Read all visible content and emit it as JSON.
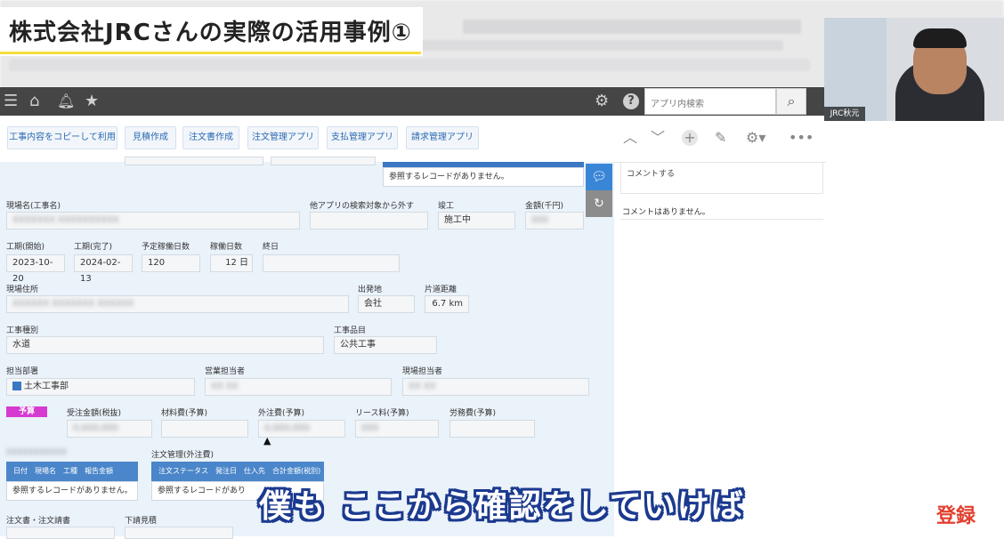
{
  "banner": {
    "title": "株式会社JRCさんの実際の活用事例①"
  },
  "search": {
    "placeholder": "アプリ内検索"
  },
  "actions": [
    {
      "label": "工事内容をコピーして利用"
    },
    {
      "label": "見積作成"
    },
    {
      "label": "注文書作成"
    },
    {
      "label": "注文管理アプリ"
    },
    {
      "label": "支払管理アプリ"
    },
    {
      "label": "請求管理アプリ"
    }
  ],
  "icons": {
    "menu": "menu-icon",
    "home": "home-icon",
    "bell": "bell-icon",
    "star": "star-icon",
    "gear": "gear-icon",
    "help": "help-icon",
    "search": "search-icon",
    "prev": "chevron-up-icon",
    "next": "chevron-down-icon",
    "add": "plus-icon",
    "edit": "edit-icon",
    "settings": "gear-icon",
    "more": "more-icon"
  },
  "colors": {
    "header": "#454545",
    "form_bg": "#eaf2fa",
    "table_head": "#4a86c9",
    "budget_tag": "#d63ad0",
    "subtitle_outline": "#1b3a8f"
  },
  "form": {
    "ref_none_top": "参照するレコードがありません。",
    "site_name_label": "現場名(工事名)",
    "exclude_label": "他アプリの検索対象から外す",
    "completion_label": "竣工",
    "completion_value": "施工中",
    "amount_label": "金額(千円)",
    "start_label": "工期(開始)",
    "start_value": "2023-10-20",
    "end_label": "工期(完了)",
    "end_value": "2024-02-13",
    "planned_days_label": "予定稼働日数",
    "planned_days_value": "120",
    "working_days_label": "稼働日数",
    "working_days_value": "12",
    "working_days_unit": "日",
    "final_day_label": "終日",
    "address_label": "現場住所",
    "departure_label": "出発地",
    "departure_value": "会社",
    "distance_label": "片道距離",
    "distance_value": "6.7 km",
    "type_label": "工事種別",
    "type_value": "水道",
    "category_label": "工事品目",
    "category_value": "公共工事",
    "dept_label": "担当部署",
    "dept_value": "土木工事部",
    "sales_label": "営業担当者",
    "site_mgr_label": "現場担当者",
    "budget_tag": "予算",
    "order_amount_label": "受注金額(税抜)",
    "material_label": "材料費(予算)",
    "outsource_label": "外注費(予算)",
    "lease_label": "リース料(予算)",
    "labor_label": "労務費(予算)",
    "order_mgmt_label": "注文管理(外注費)",
    "report_cols": [
      "日付",
      "現場名",
      "工種",
      "報告金額"
    ],
    "report_empty": "参照するレコードがありません。",
    "order_cols": [
      "注文ステータス",
      "発注日",
      "仕入先",
      "合計金額(税別)"
    ],
    "order_empty": "参照するレコードがあり",
    "purchase_label": "注文書・注文請書",
    "sub_estimate_label": "下請見積"
  },
  "comments": {
    "placeholder": "コメントする",
    "none": "コメントはありません。"
  },
  "webcam": {
    "label": "JRC秋元"
  },
  "subtitle": "僕も ここから確認をしていけば",
  "register": "登録"
}
